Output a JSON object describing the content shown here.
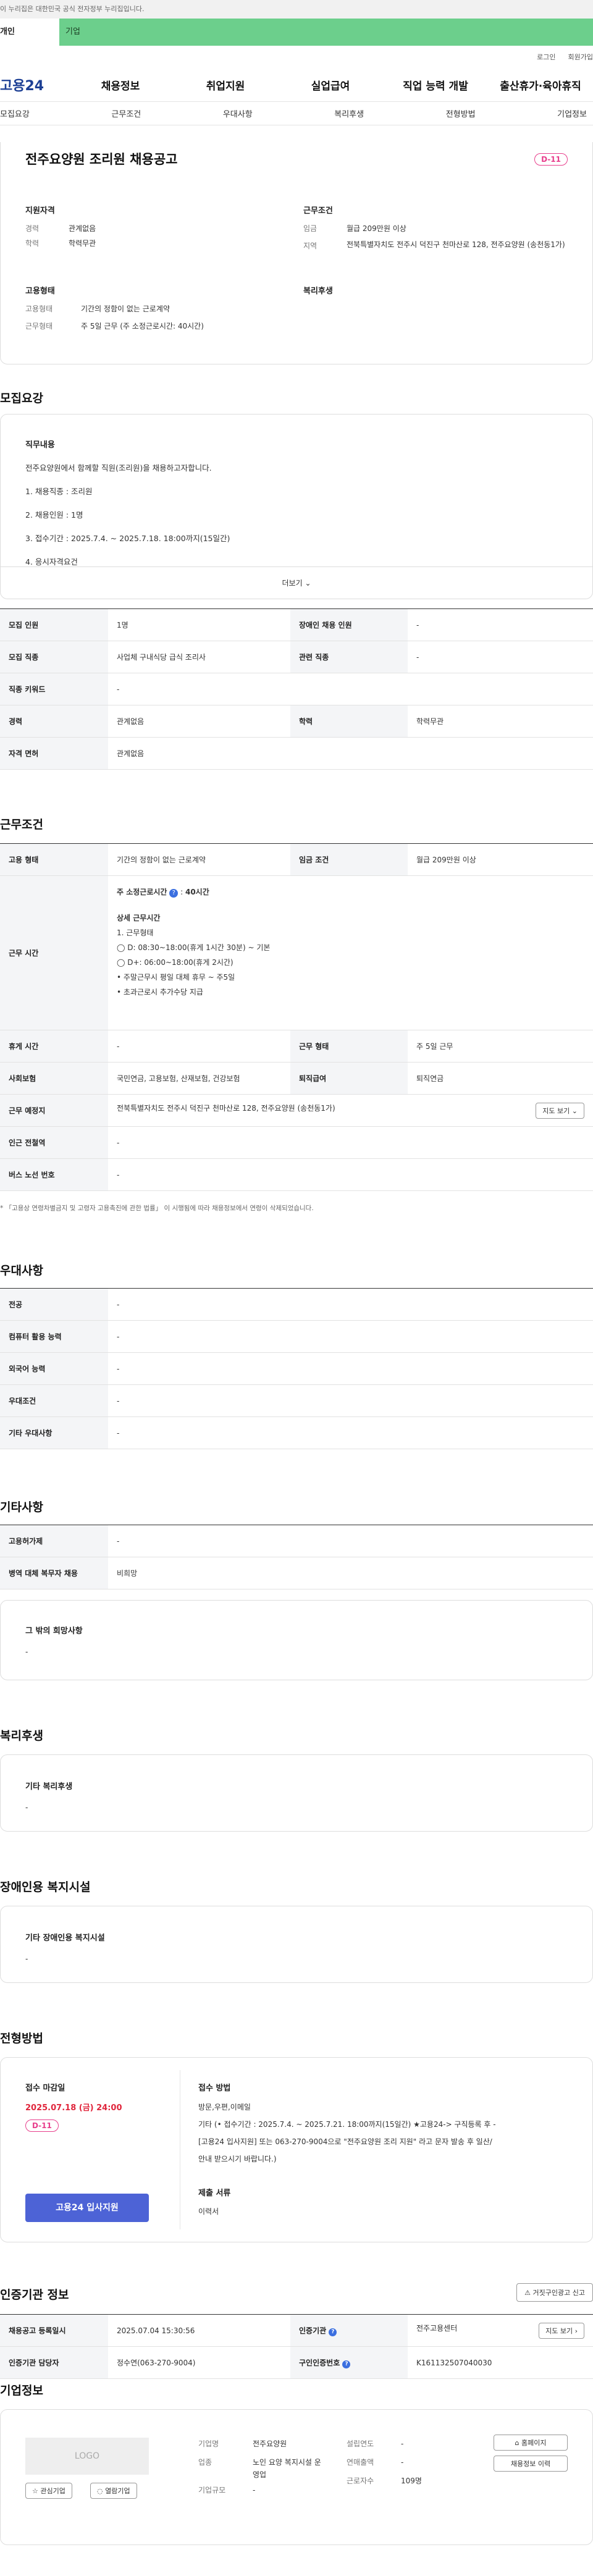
{
  "gov_notice": "이 누리집은 대한민국 공식 전자정부 누리집입니다.",
  "user_tabs": [
    "개인",
    "기업"
  ],
  "util": [
    "로그인",
    "회원가입"
  ],
  "logo": "고용24",
  "gnb": [
    "채용정보",
    "취업지원",
    "실업급여",
    "직업 능력 개발",
    "출산휴가·육아휴직"
  ],
  "snb": [
    "모집요강",
    "근무조건",
    "우대사항",
    "복리후생",
    "전형방법",
    "기업정보"
  ],
  "summary": {
    "title": "전주요양원 조리원 채용공고",
    "dday": "D-11",
    "qual_h": "지원자격",
    "career_k": "경력",
    "career_v": "관계없음",
    "edu_k": "학력",
    "edu_v": "학력무관",
    "cond_h": "근무조건",
    "wage_k": "임금",
    "wage_v": "월급 209만원 이상",
    "loc_k": "지역",
    "loc_v": "전북특별자치도 전주시 덕진구 천마산로 128, 전주요양원 (송천동1가)",
    "emp_h": "고용형태",
    "type_k": "고용형태",
    "type_v": "기간의 정함이 없는 근로계약",
    "hours_k": "근무형태",
    "hours_v": "주 5일 근무 (주 소정근로시간: 40시간)",
    "welfare_h": "복리후생"
  },
  "recruit": {
    "h": "모집요강",
    "job_h": "직무내용",
    "lines": [
      "전주요양원에서 함께할 직원(조리원)을 채용하고자합니다.",
      "1. 채용직종 : 조리원",
      "2. 채용인원 : 1명",
      "3. 접수기간 : 2025.7.4. ~ 2025.7.18. 18:00까지(15일간)",
      "4. 응시자격요건"
    ],
    "more": "더보기",
    "rows": [
      [
        "모집 인원",
        "1명",
        "장애인 채용 인원",
        "-"
      ],
      [
        "모집 직종",
        "사업체 구내식당 급식 조리사",
        "관련 직종",
        "-"
      ],
      [
        "직종 키워드",
        "-"
      ],
      [
        "경력",
        "관계없음",
        "학력",
        "학력무관"
      ],
      [
        "자격 면허",
        "관계없음"
      ]
    ]
  },
  "cond": {
    "h": "근무조건",
    "emp_k": "고용 형태",
    "emp_v": "기간의 정함이 없는 근로계약",
    "wage_k": "임금 조건",
    "wage_v": "월급 209만원 이상",
    "time_k": "근무 시간",
    "time_lines": [
      "주 소정근로시간",
      "40시간",
      "상세 근무시간",
      "1. 근무형태",
      "◯ D: 08:30~18:00(휴게 1시간 30분) ~ 기본",
      "◯ D+: 06:00~18:00(휴게 2시간)",
      "• 주말근무시 평일 대체 휴무 ~ 주5일",
      "• 초과근로시 추가수당 지급"
    ],
    "rest_k": "휴게 시간",
    "rest_v": "-",
    "form_k": "근무 형태",
    "form_v": "주 5일 근무",
    "ins_k": "사회보험",
    "ins_v": "국민연금, 고용보험, 산재보험, 건강보험",
    "ret_k": "퇴직급여",
    "ret_v": "퇴직연금",
    "place_k": "근무 예정지",
    "place_v": "전북특별자치도 전주시 덕진구 천마산로 128, 전주요양원 (송천동1가)",
    "map_btn": "지도 보기",
    "sub_k": "인근 전철역",
    "sub_v": "-",
    "bus_k": "버스 노선 번호",
    "bus_v": "-",
    "note": "* 「고용상 연령차별금지 및 고령자 고용촉진에 관한 법률」 이 시행됨에 따라 채용정보에서 연령이 삭제되었습니다."
  },
  "pref": {
    "h": "우대사항",
    "rows": [
      [
        "전공",
        "-"
      ],
      [
        "컴퓨터 활용 능력",
        "-"
      ],
      [
        "외국어 능력",
        "-"
      ],
      [
        "우대조건",
        "-"
      ],
      [
        "기타 우대사항",
        "-"
      ]
    ]
  },
  "etc": {
    "h": "기타사항",
    "rows": [
      [
        "고용허가제",
        "-"
      ],
      [
        "병역 대체 복무자 채용",
        "비희망"
      ]
    ],
    "other_h": "그 밖의 희망사항",
    "other_v": "-"
  },
  "welfare": {
    "h": "복리후생",
    "sub": "기타 복리후생",
    "v": "-"
  },
  "disab": {
    "h": "장애인용 복지시설",
    "sub": "기타 장애인용 복지시설",
    "v": "-"
  },
  "select": {
    "h": "전형방법",
    "deadline_h": "접수 마감일",
    "deadline": "2025.07.18 (금) 24:00",
    "dday": "D-11",
    "apply_btn": "고용24 입사지원",
    "method_h": "접수 방법",
    "method_lines": [
      "방문,우편,이메일",
      "기타 (• 접수기간 : 2025.7.4. ~ 2025.7.21. 18:00까지(15일간) ★고용24-> 구직등록 후 -",
      "[고용24 입사지원] 또는 063-270-9004으로 \"전주요양원 조리 지원\" 라고 문자 발송 후 일산/",
      "안내 받으시기 바랍니다.)"
    ],
    "docs_h": "제출 서류",
    "docs_v": "이력서"
  },
  "agency": {
    "h": "인증기관 정보",
    "report_btn": "거짓구인광고 신고",
    "rows": [
      [
        "채용공고 등록일시",
        "2025.07.04 15:30:56",
        "인증기관",
        "전주고용센터"
      ],
      [
        "인증기관 담당자",
        "정수연(063-270-9004)",
        "구인인증번호",
        "K161132507040030"
      ]
    ],
    "map_btn": "지도 보기"
  },
  "company": {
    "h": "기업정보",
    "logo": "LOGO",
    "fav": "관심기업",
    "follow": "열람기업",
    "fields": [
      [
        "기업명",
        "전주요양원"
      ],
      [
        "업종",
        "노인 요양 복지시설 운영업"
      ],
      [
        "기업규모",
        "-"
      ]
    ],
    "fields2": [
      [
        "설립연도",
        "-"
      ],
      [
        "연매출액",
        "-"
      ],
      [
        "근로자수",
        "109명"
      ]
    ],
    "home_btn": "홈페이지",
    "jobs_btn": "채용정보 이력"
  }
}
